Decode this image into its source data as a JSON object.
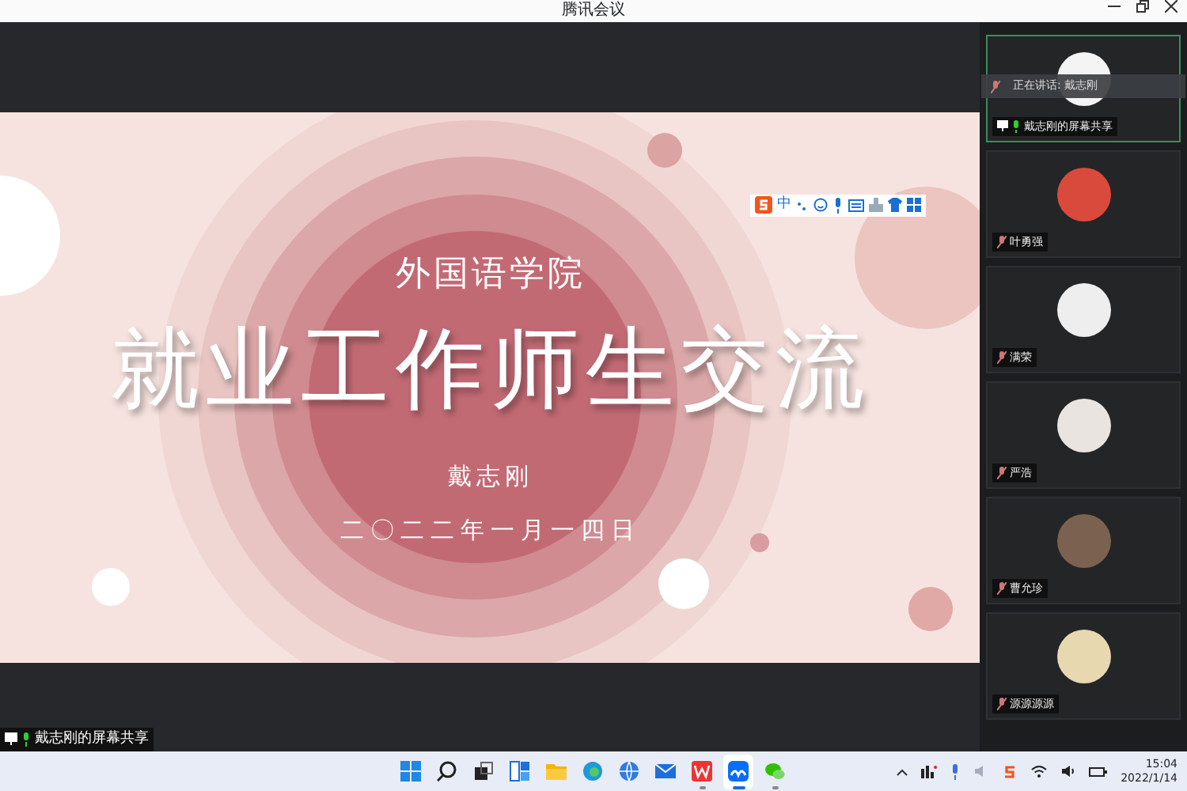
{
  "window": {
    "title": "腾讯会议"
  },
  "slide": {
    "subtitle": "外国语学院",
    "title": "就业工作师生交流",
    "presenter": "戴志刚",
    "date": "二〇二二年一月一四日"
  },
  "ime_toolbar": {
    "mode": "中"
  },
  "participants": [
    {
      "name": "戴志刚的屏幕共享",
      "selected": true,
      "speaking_label": "正在讲话: 戴志刚",
      "sharing": true
    },
    {
      "name": "叶勇强",
      "selected": false,
      "sharing": false
    },
    {
      "name": "满荣",
      "selected": false,
      "sharing": false
    },
    {
      "name": "严浩",
      "selected": false,
      "sharing": false
    },
    {
      "name": "曹允珍",
      "selected": false,
      "sharing": false
    },
    {
      "name": "源源源源",
      "selected": false,
      "sharing": false
    }
  ],
  "share_label": "戴志刚的屏幕共享",
  "taskbar": {
    "apps": [
      {
        "kind": "start",
        "active": false,
        "running": false
      },
      {
        "kind": "search",
        "active": false,
        "running": false
      },
      {
        "kind": "taskview",
        "active": false,
        "running": false
      },
      {
        "kind": "widgets",
        "active": false,
        "running": false
      },
      {
        "kind": "folder",
        "active": false,
        "running": false
      },
      {
        "kind": "edge",
        "active": false,
        "running": false
      },
      {
        "kind": "globe",
        "active": false,
        "running": false
      },
      {
        "kind": "mail",
        "active": false,
        "running": false
      },
      {
        "kind": "wps",
        "active": false,
        "running": true
      },
      {
        "kind": "meeting",
        "active": true,
        "running": true
      },
      {
        "kind": "wechat",
        "active": false,
        "running": true
      }
    ],
    "time": "15:04",
    "date": "2022/1/14"
  }
}
